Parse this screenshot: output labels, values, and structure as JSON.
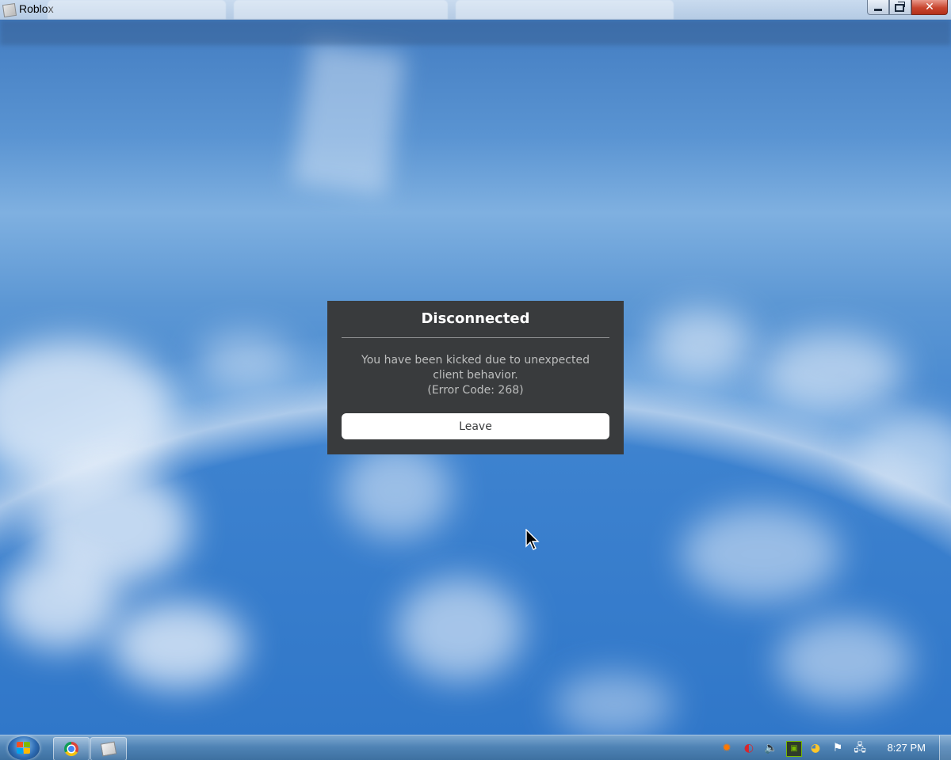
{
  "window": {
    "title": "Roblox",
    "controls": {
      "close_glyph": "✕"
    }
  },
  "dialog": {
    "title": "Disconnected",
    "message": "You have been kicked due to unexpected client behavior.",
    "error_code": "(Error Code: 268)",
    "leave_label": "Leave"
  },
  "taskbar": {
    "clock": "8:27 PM",
    "items": [
      {
        "icon": "chrome-icon"
      },
      {
        "icon": "roblox-icon"
      }
    ],
    "tray_icons": [
      "avast-icon",
      "network-swirl-icon",
      "volume-icon",
      "nvidia-icon",
      "shield-icon",
      "flag-icon",
      "network-icon"
    ]
  },
  "colors": {
    "dialog_bg": "#393b3d",
    "dialog_title": "#ffffff",
    "dialog_text": "#bdbebe",
    "button_bg": "#ffffff",
    "button_text": "#393b3d"
  }
}
